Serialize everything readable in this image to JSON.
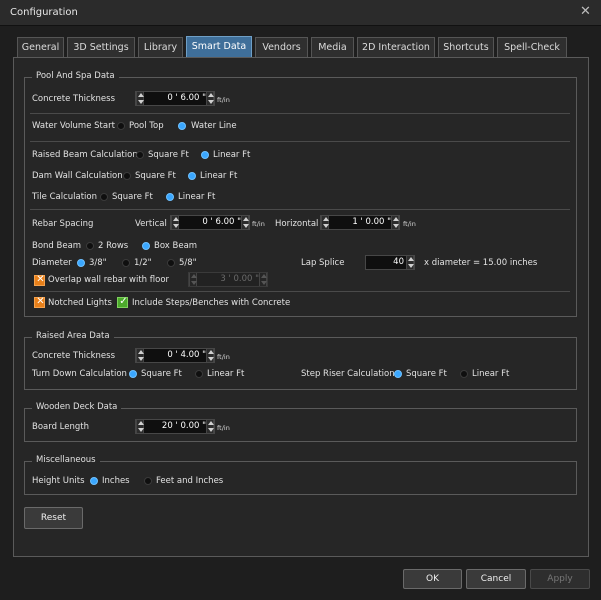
{
  "window": {
    "title": "Configuration",
    "close": "✕"
  },
  "tabs": [
    "General",
    "3D Settings",
    "Library",
    "Smart Data",
    "Vendors",
    "Media",
    "2D Interaction",
    "Shortcuts",
    "Spell-Check"
  ],
  "pool": {
    "title": "Pool And Spa Data",
    "concrete_thickness": {
      "label": "Concrete Thickness",
      "value": "0 ' 6.00 \"",
      "unit": "ft/in"
    },
    "water_volume": {
      "label": "Water Volume Start",
      "opt1": "Pool Top",
      "opt2": "Water Line"
    },
    "raised_beam": {
      "label": "Raised Beam Calculation",
      "opt1": "Square Ft",
      "opt2": "Linear Ft"
    },
    "dam_wall": {
      "label": "Dam Wall Calculation",
      "opt1": "Square Ft",
      "opt2": "Linear Ft"
    },
    "tile": {
      "label": "Tile Calculation",
      "opt1": "Square Ft",
      "opt2": "Linear Ft"
    },
    "rebar": {
      "label": "Rebar Spacing",
      "vertical_label": "Vertical",
      "vertical_value": "0 ' 6.00 \"",
      "horizontal_label": "Horizontal",
      "horizontal_value": "1 ' 0.00 \"",
      "unit": "ft/in"
    },
    "bond_beam": {
      "label": "Bond Beam",
      "opt1": "2 Rows",
      "opt2": "Box Beam"
    },
    "diameter": {
      "label": "Diameter",
      "opt1": "3/8\"",
      "opt2": "1/2\"",
      "opt3": "5/8\""
    },
    "lap_splice": {
      "label": "Lap Splice",
      "value": "40",
      "suffix": "x diameter = 15.00 inches"
    },
    "overlap": {
      "label": "Overlap wall rebar with floor",
      "value": "3 ' 0.00 \""
    },
    "notched_lights": "Notched Lights",
    "include_steps": "Include Steps/Benches with Concrete"
  },
  "raised": {
    "title": "Raised Area Data",
    "concrete_thickness": {
      "label": "Concrete Thickness",
      "value": "0 ' 4.00 \"",
      "unit": "ft/in"
    },
    "turn_down": {
      "label": "Turn Down Calculation",
      "opt1": "Square Ft",
      "opt2": "Linear Ft"
    },
    "step_riser": {
      "label": "Step Riser Calculation",
      "opt1": "Square Ft",
      "opt2": "Linear Ft"
    }
  },
  "deck": {
    "title": "Wooden Deck Data",
    "board_length": {
      "label": "Board Length",
      "value": "20 ' 0.00 \"",
      "unit": "ft/in"
    }
  },
  "misc": {
    "title": "Miscellaneous",
    "height_units": {
      "label": "Height Units",
      "opt1": "Inches",
      "opt2": "Feet and Inches"
    }
  },
  "buttons": {
    "reset": "Reset",
    "ok": "OK",
    "cancel": "Cancel",
    "apply": "Apply"
  }
}
